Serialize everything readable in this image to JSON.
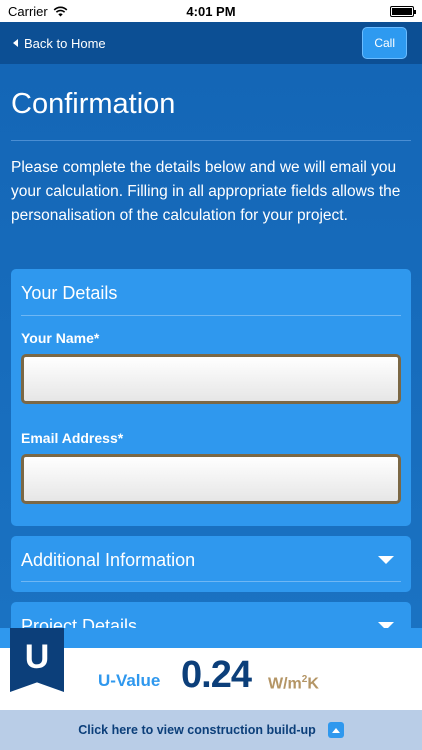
{
  "status_bar": {
    "carrier": "Carrier",
    "time": "4:01 PM"
  },
  "nav": {
    "back_label": "Back to Home",
    "call_label": "Call"
  },
  "page": {
    "title": "Confirmation",
    "intro": "Please complete the details below and we will email you your calculation. Filling in all appropriate fields allows the personalisation of the calculation for your project."
  },
  "your_details": {
    "heading": "Your Details",
    "name_label": "Your Name*",
    "name_value": "",
    "email_label": "Email Address*",
    "email_value": ""
  },
  "additional_info": {
    "heading": "Additional Information"
  },
  "project_details": {
    "heading": "Project Details"
  },
  "bottom": {
    "logo_letter": "U",
    "uvalue_label": "U-Value",
    "uvalue_number": "0.24",
    "unit_base": "W/m",
    "unit_exp": "2",
    "unit_tail": "K",
    "buildup_label": "Click here to view construction build-up"
  },
  "icons": {
    "back": "chevron-left-icon",
    "expand": "chevron-down-icon",
    "buildup": "chevron-up-icon",
    "wifi": "wifi-icon",
    "battery": "battery-icon"
  },
  "colors": {
    "background": "#1565b8",
    "nav": "#0c4f94",
    "panel": "#2f98ee",
    "brand_dark": "#0c3f7a",
    "unit_gold": "#b49565",
    "buildup_strip": "#b9cde7"
  }
}
